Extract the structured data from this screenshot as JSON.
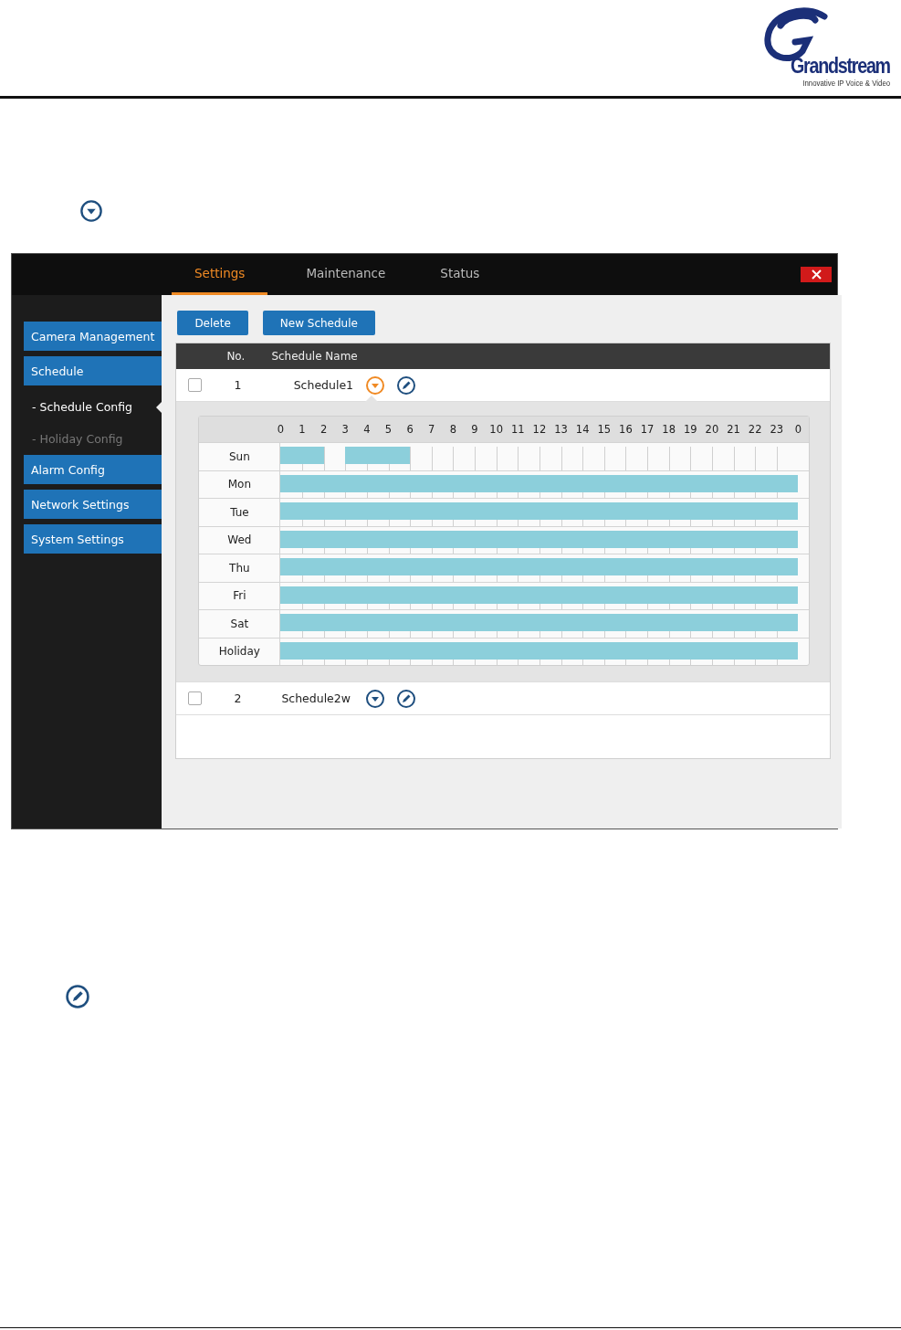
{
  "logo": {
    "wordmark": "Grandstream",
    "tagline": "Innovative IP Voice & Video"
  },
  "window": {
    "tabs": [
      {
        "label": "Settings",
        "selected": true
      },
      {
        "label": "Maintenance",
        "selected": false
      },
      {
        "label": "Status",
        "selected": false
      }
    ],
    "sidebar": {
      "items": [
        {
          "kind": "section",
          "label": "Camera Management"
        },
        {
          "kind": "section",
          "label": "Schedule"
        },
        {
          "kind": "sub",
          "label": "- Schedule Config",
          "selected": true
        },
        {
          "kind": "sub",
          "label": "- Holiday Config",
          "selected": false
        },
        {
          "kind": "section",
          "label": "Alarm Config"
        },
        {
          "kind": "section",
          "label": "Network Settings"
        },
        {
          "kind": "section",
          "label": "System Settings"
        }
      ]
    },
    "buttons": [
      "Delete",
      "New Schedule"
    ],
    "table": {
      "columns": [
        "No.",
        "Schedule Name"
      ],
      "rows": [
        {
          "checked": false,
          "no": "1",
          "name": "Schedule1",
          "expanded": true,
          "grid": {
            "hours": [
              "0",
              "1",
              "2",
              "3",
              "4",
              "5",
              "6",
              "7",
              "8",
              "9",
              "10",
              "11",
              "12",
              "13",
              "14",
              "15",
              "16",
              "17",
              "18",
              "19",
              "20",
              "21",
              "22",
              "23",
              "0"
            ],
            "days": [
              {
                "label": "Sun",
                "slots": [
                  true,
                  true,
                  false,
                  true,
                  true,
                  true,
                  false,
                  false,
                  false,
                  false,
                  false,
                  false,
                  false,
                  false,
                  false,
                  false,
                  false,
                  false,
                  false,
                  false,
                  false,
                  false,
                  false,
                  false
                ]
              },
              {
                "label": "Mon",
                "slots": [
                  true,
                  true,
                  true,
                  true,
                  true,
                  true,
                  true,
                  true,
                  true,
                  true,
                  true,
                  true,
                  true,
                  true,
                  true,
                  true,
                  true,
                  true,
                  true,
                  true,
                  true,
                  true,
                  true,
                  true
                ]
              },
              {
                "label": "Tue",
                "slots": [
                  true,
                  true,
                  true,
                  true,
                  true,
                  true,
                  true,
                  true,
                  true,
                  true,
                  true,
                  true,
                  true,
                  true,
                  true,
                  true,
                  true,
                  true,
                  true,
                  true,
                  true,
                  true,
                  true,
                  true
                ]
              },
              {
                "label": "Wed",
                "slots": [
                  true,
                  true,
                  true,
                  true,
                  true,
                  true,
                  true,
                  true,
                  true,
                  true,
                  true,
                  true,
                  true,
                  true,
                  true,
                  true,
                  true,
                  true,
                  true,
                  true,
                  true,
                  true,
                  true,
                  true
                ]
              },
              {
                "label": "Thu",
                "slots": [
                  true,
                  true,
                  true,
                  true,
                  true,
                  true,
                  true,
                  true,
                  true,
                  true,
                  true,
                  true,
                  true,
                  true,
                  true,
                  true,
                  true,
                  true,
                  true,
                  true,
                  true,
                  true,
                  true,
                  true
                ]
              },
              {
                "label": "Fri",
                "slots": [
                  true,
                  true,
                  true,
                  true,
                  true,
                  true,
                  true,
                  true,
                  true,
                  true,
                  true,
                  true,
                  true,
                  true,
                  true,
                  true,
                  true,
                  true,
                  true,
                  true,
                  true,
                  true,
                  true,
                  true
                ]
              },
              {
                "label": "Sat",
                "slots": [
                  true,
                  true,
                  true,
                  true,
                  true,
                  true,
                  true,
                  true,
                  true,
                  true,
                  true,
                  true,
                  true,
                  true,
                  true,
                  true,
                  true,
                  true,
                  true,
                  true,
                  true,
                  true,
                  true,
                  true
                ]
              },
              {
                "label": "Holiday",
                "slots": [
                  true,
                  true,
                  true,
                  true,
                  true,
                  true,
                  true,
                  true,
                  true,
                  true,
                  true,
                  true,
                  true,
                  true,
                  true,
                  true,
                  true,
                  true,
                  true,
                  true,
                  true,
                  true,
                  true,
                  true
                ]
              }
            ]
          }
        },
        {
          "checked": false,
          "no": "2",
          "name": "Schedule2w",
          "expanded": false
        }
      ]
    }
  }
}
